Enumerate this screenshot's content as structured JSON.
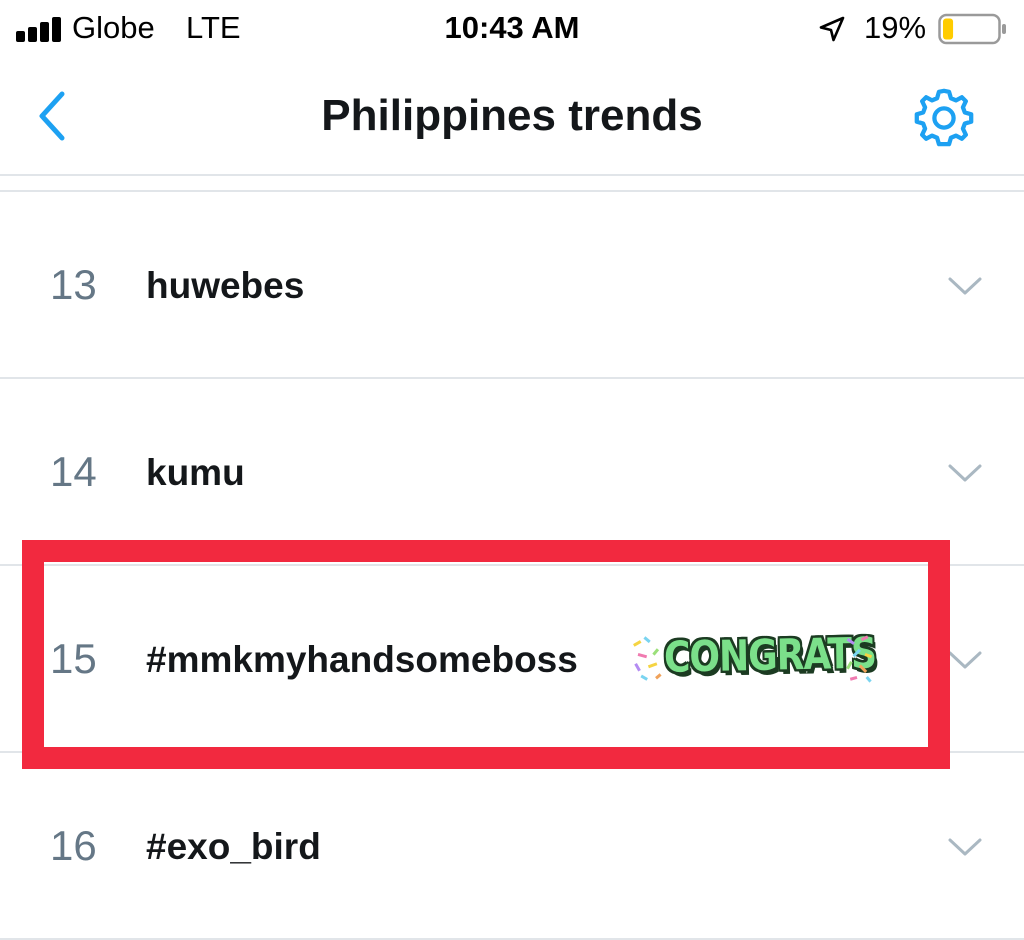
{
  "status_bar": {
    "carrier": "Globe",
    "network": "LTE",
    "time": "10:43 AM",
    "battery_percent": "19%",
    "battery_level": 0.19,
    "battery_color": "#ffcc00",
    "icons": [
      "signal-bars-icon",
      "location-arrow-icon",
      "battery-icon"
    ]
  },
  "nav": {
    "title": "Philippines trends",
    "back_icon": "chevron-left-icon",
    "settings_icon": "gear-icon",
    "accent_color": "#1da1f2"
  },
  "trends": [
    {
      "rank": "13",
      "name": "huwebes"
    },
    {
      "rank": "14",
      "name": "kumu"
    },
    {
      "rank": "15",
      "name": "#mmkmyhandsomeboss",
      "sticker": "CONGRATS",
      "highlighted": true
    },
    {
      "rank": "16",
      "name": "#exo_bird"
    }
  ],
  "colors": {
    "highlight": "#f2293f",
    "rank_text": "#657786",
    "separator": "#e1e5e9",
    "chevron": "#aab8c2"
  }
}
